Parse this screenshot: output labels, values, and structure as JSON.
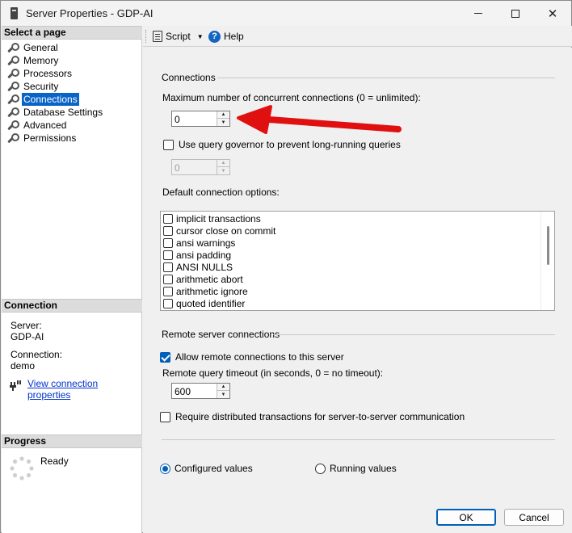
{
  "window": {
    "title": "Server Properties - GDP-AI"
  },
  "left_pane": {
    "select_page_header": "Select a page",
    "pages": [
      {
        "label": "General"
      },
      {
        "label": "Memory"
      },
      {
        "label": "Processors"
      },
      {
        "label": "Security"
      },
      {
        "label": "Connections",
        "selected": true
      },
      {
        "label": "Database Settings"
      },
      {
        "label": "Advanced"
      },
      {
        "label": "Permissions"
      }
    ],
    "connection_header": "Connection",
    "server_label": "Server:",
    "server_value": "GDP-AI",
    "connection_label": "Connection:",
    "connection_value": "demo",
    "view_connection_link": "View connection properties",
    "progress_header": "Progress",
    "progress_status": "Ready"
  },
  "toolbar": {
    "script_label": "Script",
    "help_label": "Help"
  },
  "connections": {
    "group_title": "Connections",
    "max_connections_label": "Maximum number of concurrent connections (0 = unlimited):",
    "max_connections_value": "0",
    "query_governor_label": "Use query governor to prevent long-running queries",
    "query_governor_checked": false,
    "query_governor_value": "0",
    "default_options_label": "Default connection options:",
    "options": [
      {
        "label": "implicit transactions",
        "checked": false
      },
      {
        "label": "cursor close on commit",
        "checked": false
      },
      {
        "label": "ansi warnings",
        "checked": false
      },
      {
        "label": "ansi padding",
        "checked": false
      },
      {
        "label": "ANSI NULLS",
        "checked": false
      },
      {
        "label": "arithmetic abort",
        "checked": false
      },
      {
        "label": "arithmetic ignore",
        "checked": false
      },
      {
        "label": "quoted identifier",
        "checked": false
      }
    ]
  },
  "remote": {
    "group_title": "Remote server connections",
    "allow_remote_label": "Allow remote connections to this server",
    "allow_remote_checked": true,
    "timeout_label": "Remote query timeout (in seconds, 0 = no timeout):",
    "timeout_value": "600",
    "require_distributed_label": "Require distributed transactions for server-to-server communication",
    "require_distributed_checked": false
  },
  "values_mode": {
    "configured_label": "Configured values",
    "running_label": "Running values",
    "selected": "configured"
  },
  "footer": {
    "ok_label": "OK",
    "cancel_label": "Cancel"
  },
  "colors": {
    "selection": "#0a64c8",
    "accent": "#005fb8",
    "annotation_arrow": "#e01010"
  }
}
